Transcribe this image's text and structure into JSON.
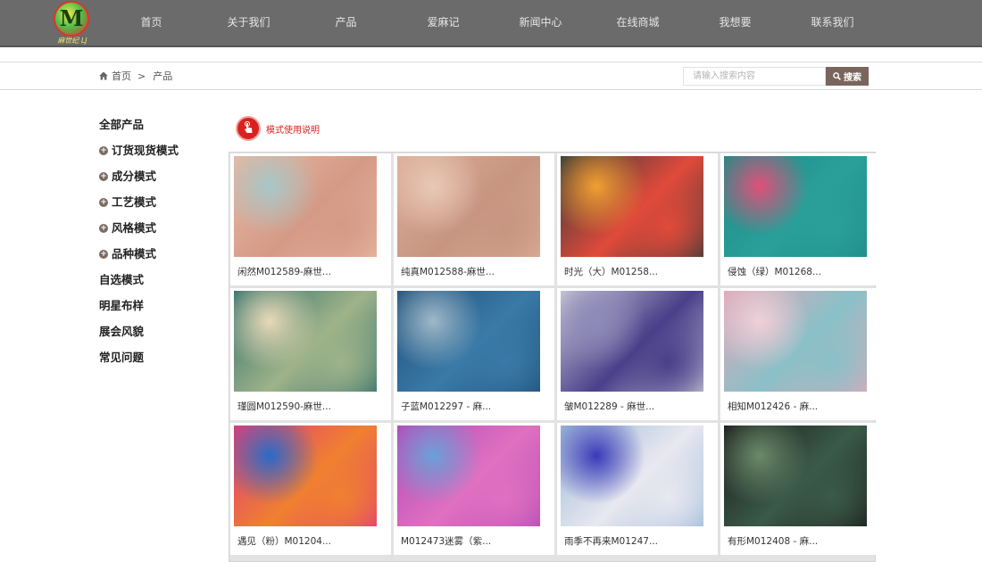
{
  "logo": {
    "mark": "M",
    "script": "麻世纪 LJ"
  },
  "nav": {
    "items": [
      "首页",
      "关于我们",
      "产品",
      "爱麻记",
      "新闻中心",
      "在线商城",
      "我想要",
      "联系我们"
    ]
  },
  "breadcrumb": {
    "home": "首页",
    "separator": ">",
    "current": "产品"
  },
  "search": {
    "placeholder": "请输入搜索内容",
    "button_label": "搜索"
  },
  "sidebar": {
    "items": [
      {
        "label": "全部产品",
        "expandable": false
      },
      {
        "label": "订货现货模式",
        "expandable": true
      },
      {
        "label": "成分模式",
        "expandable": true
      },
      {
        "label": "工艺模式",
        "expandable": true
      },
      {
        "label": "风格模式",
        "expandable": true
      },
      {
        "label": "品种模式",
        "expandable": true
      },
      {
        "label": "自选模式",
        "expandable": false
      },
      {
        "label": "明星布样",
        "expandable": false
      },
      {
        "label": "展会风貌",
        "expandable": false
      },
      {
        "label": "常见问题",
        "expandable": false
      }
    ]
  },
  "guide": {
    "label": "模式使用说明"
  },
  "products": [
    {
      "name": "闲然M012589-麻世...",
      "colors": [
        "#e8b9a3",
        "#d49a86",
        "#a7c7c9"
      ]
    },
    {
      "name": "纯真M012588-麻世...",
      "colors": [
        "#dcae98",
        "#c79580",
        "#e9c9b8"
      ]
    },
    {
      "name": "时光（大）M01258...",
      "colors": [
        "#2f3a3a",
        "#e04a3a",
        "#f0a030"
      ]
    },
    {
      "name": "侵蚀（绿）M01268...",
      "colors": [
        "#1f8a86",
        "#2a9f99",
        "#e0507a"
      ]
    },
    {
      "name": "瑾圆M012590-麻世...",
      "colors": [
        "#2f6f6b",
        "#9fb38a",
        "#e8d9b8"
      ]
    },
    {
      "name": "子蓝M012297 - 麻...",
      "colors": [
        "#1f4f7a",
        "#3a7aa8",
        "#9fb8c8"
      ]
    },
    {
      "name": "皱M012289 - 麻世...",
      "colors": [
        "#c9c9d6",
        "#4a3f8a",
        "#8e8ab8"
      ]
    },
    {
      "name": "相知M012426 - 麻...",
      "colors": [
        "#e0a8b8",
        "#8ac0c8",
        "#f0d0d8"
      ]
    },
    {
      "name": "遇见（粉）M01204...",
      "colors": [
        "#e03a7a",
        "#f08030",
        "#2a6ac8"
      ]
    },
    {
      "name": "M012473迷雾（紫...",
      "colors": [
        "#b04ab8",
        "#e070c0",
        "#6aa0d8"
      ]
    },
    {
      "name": "雨季不再来M01247...",
      "colors": [
        "#9ab8d8",
        "#e8e8f0",
        "#3a3ab8"
      ]
    },
    {
      "name": "有形M012408 - 麻...",
      "colors": [
        "#1a1a1a",
        "#3a5a48",
        "#6a8a6a"
      ]
    }
  ],
  "colors": {
    "nav_bg": "#6b6b6b",
    "search_button": "#7a655c",
    "guide_red": "#d9221f"
  }
}
